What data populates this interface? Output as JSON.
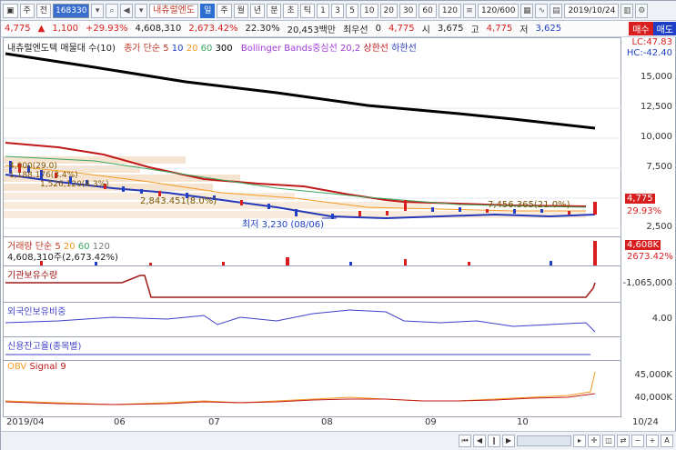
{
  "toolbar": {
    "period_buttons": [
      "주",
      "전"
    ],
    "code": "168330",
    "name": "내츄럴엔도",
    "interval_tabs": [
      "일",
      "주",
      "월",
      "년",
      "분",
      "초",
      "틱"
    ],
    "minute_buttons": [
      "1",
      "3",
      "5",
      "10",
      "20",
      "30",
      "60",
      "120"
    ],
    "count": "120/600",
    "date": "2019/10/24",
    "buy_label": "매수",
    "sell_label": "매도"
  },
  "pricebar": {
    "price": "4,775",
    "change": "1,100",
    "change_pct": "+29.93%",
    "volume": "4,608,310",
    "vol_ratio": "2,673.42%",
    "turnover": "22.30%",
    "amount": "20,453백만",
    "priority_label": "최우선",
    "priority_value": "0",
    "last": "4,775",
    "open_label": "시",
    "open": "3,675",
    "high_label": "고",
    "high": "4,775",
    "low_label": "저",
    "low": "3,625"
  },
  "price_pane": {
    "legend_title": "내츄럴엔도텍 매물대 수(10)",
    "legend_ma": "종가 단순 5",
    "legend_ma_periods": [
      "10",
      "20",
      "60",
      "300"
    ],
    "legend_bb": "Bollinger Bands중심선 20,2",
    "legend_upper": "상한선",
    "legend_lower": "하한선",
    "lc_label": "LC:47.83",
    "hc_label": "HC:-42.40",
    "ticks": [
      "15,000",
      "12,500",
      "10,000",
      "7,500",
      "5,000",
      "2,500"
    ],
    "price_badge": "4,775",
    "pct_badge": "29.93%",
    "low_annot": "최저 3,230 (08/06)",
    "annot_1": "2,843.451(8.0%)",
    "annot_2": "7,456.365(21.0%)",
    "annot_3": "1,526,120(4.3%)",
    "annot_4": "1,188,176(3.4%)",
    "annot_5": "4,000(29.0)"
  },
  "volume_pane": {
    "legend": "거래량 단순 5",
    "legend_periods": [
      "20",
      "60",
      "120"
    ],
    "value": "4,608,310주(2,673.42%)",
    "badge": "4,608K",
    "pct": "2673.42%"
  },
  "inst_pane": {
    "legend": "기관보유수량",
    "tick": "-1,065,000"
  },
  "foreign_pane": {
    "legend": "외국인보유비중",
    "tick": "4.00"
  },
  "credit_pane": {
    "legend": "신용잔고율(종목별)"
  },
  "obv_pane": {
    "legend_obv": "OBV",
    "legend_signal": "Signal 9",
    "ticks": [
      "45,000K",
      "40,000K"
    ]
  },
  "dates": [
    "2019/04",
    "06",
    "07",
    "08",
    "09",
    "10",
    "10/24"
  ],
  "status": {
    "zoom_minus": "−",
    "zoom_plus": "+",
    "zoom_a": "A"
  },
  "colors": {
    "up": "#d81e1e",
    "down": "#1f3fc7",
    "ma300": "#000000",
    "bb": "#c0392b",
    "accent": "#2c6fd1"
  }
}
